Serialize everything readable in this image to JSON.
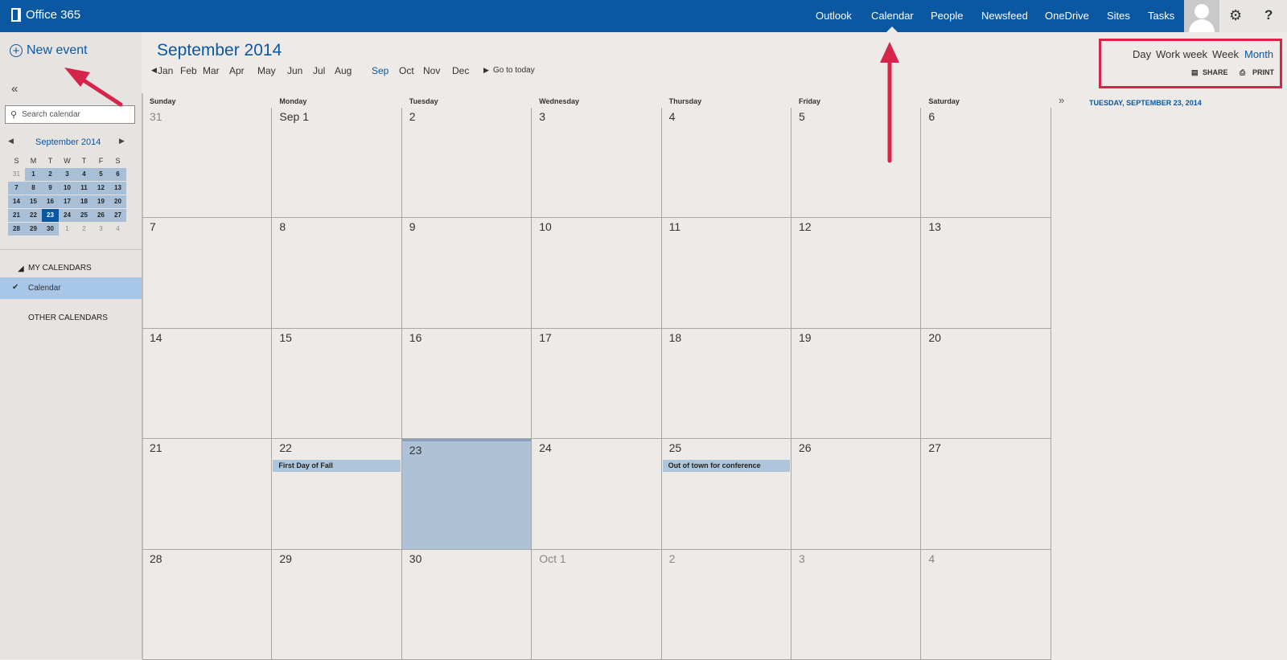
{
  "app": {
    "logo_text": "Office 365"
  },
  "nav": {
    "items": [
      "Outlook",
      "Calendar",
      "People",
      "Newsfeed",
      "OneDrive",
      "Sites",
      "Tasks"
    ],
    "active": "Calendar",
    "settings_icon": "gear-icon",
    "help_label": "?"
  },
  "sidebar": {
    "new_event": "New event",
    "collapse": "«",
    "search_placeholder": "Search calendar",
    "mini": {
      "title": "September 2014",
      "dow": [
        "S",
        "M",
        "T",
        "W",
        "T",
        "F",
        "S"
      ],
      "weeks": [
        [
          "31",
          "1",
          "2",
          "3",
          "4",
          "5",
          "6"
        ],
        [
          "7",
          "8",
          "9",
          "10",
          "11",
          "12",
          "13"
        ],
        [
          "14",
          "15",
          "16",
          "17",
          "18",
          "19",
          "20"
        ],
        [
          "21",
          "22",
          "23",
          "24",
          "25",
          "26",
          "27"
        ],
        [
          "28",
          "29",
          "30",
          "1",
          "2",
          "3",
          "4"
        ]
      ],
      "today": "23"
    },
    "my_calendars": "MY CALENDARS",
    "calendar_item": "Calendar",
    "other_calendars": "OTHER CALENDARS"
  },
  "header": {
    "month_title": "September 2014",
    "months": [
      "Jan",
      "Feb",
      "Mar",
      "Apr",
      "May",
      "Jun",
      "Jul",
      "Aug",
      "Sep",
      "Oct",
      "Nov",
      "Dec"
    ],
    "selected_month": "Sep",
    "go_to_today": "Go to today"
  },
  "views": {
    "items": [
      "Day",
      "Work week",
      "Week",
      "Month"
    ],
    "selected": "Month",
    "share": "SHARE",
    "print": "PRINT"
  },
  "grid": {
    "day_headers": [
      "Sunday",
      "Monday",
      "Tuesday",
      "Wednesday",
      "Thursday",
      "Friday",
      "Saturday"
    ],
    "weeks": [
      [
        "31",
        "Sep 1",
        "2",
        "3",
        "4",
        "5",
        "6"
      ],
      [
        "7",
        "8",
        "9",
        "10",
        "11",
        "12",
        "13"
      ],
      [
        "14",
        "15",
        "16",
        "17",
        "18",
        "19",
        "20"
      ],
      [
        "21",
        "22",
        "23",
        "24",
        "25",
        "26",
        "27"
      ],
      [
        "28",
        "29",
        "30",
        "Oct 1",
        "2",
        "3",
        "4"
      ]
    ],
    "events": [
      {
        "week": 3,
        "day": 1,
        "title": "First Day of Fall"
      },
      {
        "week": 3,
        "day": 4,
        "title": "Out of town for conference"
      }
    ]
  },
  "agenda": {
    "date": "TUESDAY, SEPTEMBER 23, 2014",
    "toggle": "»"
  },
  "colors": {
    "brand": "#0b58a2",
    "annotation": "#d6244a"
  }
}
